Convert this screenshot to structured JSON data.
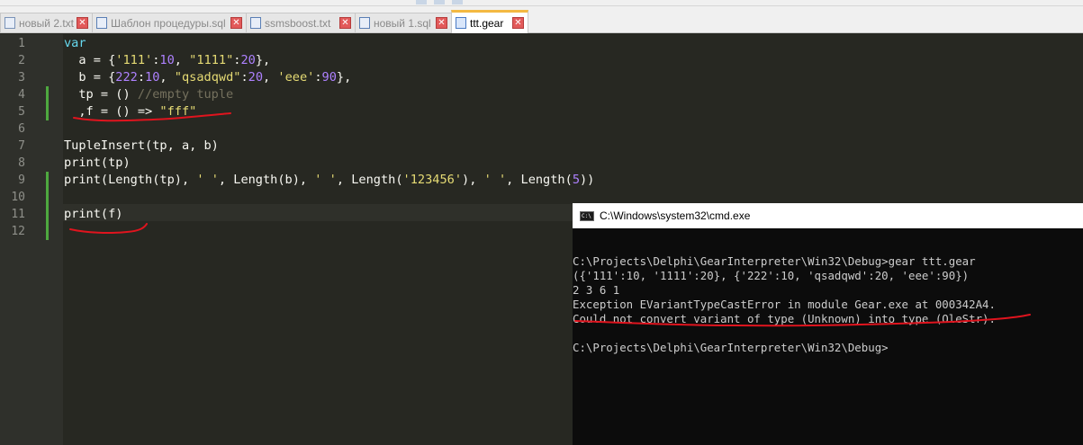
{
  "tabs": [
    {
      "label": "новый 2.txt",
      "active": false
    },
    {
      "label": "Шаблон процедуры.sql",
      "active": false
    },
    {
      "label": "ssmsboost.txt",
      "active": false
    },
    {
      "label": "новый 1.sql",
      "active": false
    },
    {
      "label": "ttt.gear",
      "active": true
    }
  ],
  "tab_close_glyph": "✕",
  "editor": {
    "line_numbers": [
      "1",
      "2",
      "3",
      "4",
      "5",
      "6",
      "7",
      "8",
      "9",
      "10",
      "11",
      "12"
    ],
    "lines": [
      [
        {
          "t": "var",
          "c": "kw"
        }
      ],
      [
        {
          "t": "  a = {",
          "c": "op"
        },
        {
          "t": "'111'",
          "c": "str"
        },
        {
          "t": ":",
          "c": "op"
        },
        {
          "t": "10",
          "c": "num"
        },
        {
          "t": ", ",
          "c": "op"
        },
        {
          "t": "\"1111\"",
          "c": "str"
        },
        {
          "t": ":",
          "c": "op"
        },
        {
          "t": "20",
          "c": "num"
        },
        {
          "t": "},",
          "c": "op"
        }
      ],
      [
        {
          "t": "  b = {",
          "c": "op"
        },
        {
          "t": "222",
          "c": "num"
        },
        {
          "t": ":",
          "c": "op"
        },
        {
          "t": "10",
          "c": "num"
        },
        {
          "t": ", ",
          "c": "op"
        },
        {
          "t": "\"qsadqwd\"",
          "c": "str"
        },
        {
          "t": ":",
          "c": "op"
        },
        {
          "t": "20",
          "c": "num"
        },
        {
          "t": ", ",
          "c": "op"
        },
        {
          "t": "'eee'",
          "c": "str"
        },
        {
          "t": ":",
          "c": "op"
        },
        {
          "t": "90",
          "c": "num"
        },
        {
          "t": "},",
          "c": "op"
        }
      ],
      [
        {
          "t": "  tp = () ",
          "c": "op"
        },
        {
          "t": "//empty tuple",
          "c": "cm"
        }
      ],
      [
        {
          "t": "  ,f = () => ",
          "c": "op"
        },
        {
          "t": "\"fff\"",
          "c": "str"
        }
      ],
      [],
      [
        {
          "t": "TupleInsert(tp, a, b)",
          "c": "fn"
        }
      ],
      [
        {
          "t": "print(tp)",
          "c": "fn"
        }
      ],
      [
        {
          "t": "print(Length(tp), ",
          "c": "fn"
        },
        {
          "t": "' '",
          "c": "str"
        },
        {
          "t": ", Length(b), ",
          "c": "fn"
        },
        {
          "t": "' '",
          "c": "str"
        },
        {
          "t": ", Length(",
          "c": "fn"
        },
        {
          "t": "'123456'",
          "c": "str"
        },
        {
          "t": "), ",
          "c": "fn"
        },
        {
          "t": "' '",
          "c": "str"
        },
        {
          "t": ", Length(",
          "c": "fn"
        },
        {
          "t": "5",
          "c": "num"
        },
        {
          "t": "))",
          "c": "fn"
        }
      ],
      [],
      [
        {
          "t": "print(f)",
          "c": "fn"
        }
      ],
      []
    ],
    "current_line": 11,
    "changed_lines": [
      4,
      5,
      9,
      10,
      11,
      12
    ]
  },
  "console": {
    "title": "C:\\Windows\\system32\\cmd.exe",
    "icon_text": "C:\\",
    "lines": [
      "",
      "C:\\Projects\\Delphi\\GearInterpreter\\Win32\\Debug>gear ttt.gear",
      "({'111':10, '1111':20}, {'222':10, 'qsadqwd':20, 'eee':90})",
      "2 3 6 1",
      "Exception EVariantTypeCastError in module Gear.exe at 000342A4.",
      "Could not convert variant of type (Unknown) into type (OleStr).",
      "",
      "C:\\Projects\\Delphi\\GearInterpreter\\Win32\\Debug>"
    ]
  },
  "colors": {
    "editor_bg": "#272822",
    "gutter_bg": "#2f302b",
    "keyword": "#66d9ef",
    "string": "#e6db74",
    "number": "#ae81ff",
    "comment": "#75715e",
    "text": "#f8f8f2",
    "change_marker": "#4ea83f",
    "annotation": "#e0141e",
    "active_tab_accent": "#f4b942",
    "console_bg": "#0c0c0c",
    "console_text": "#cccccc"
  }
}
